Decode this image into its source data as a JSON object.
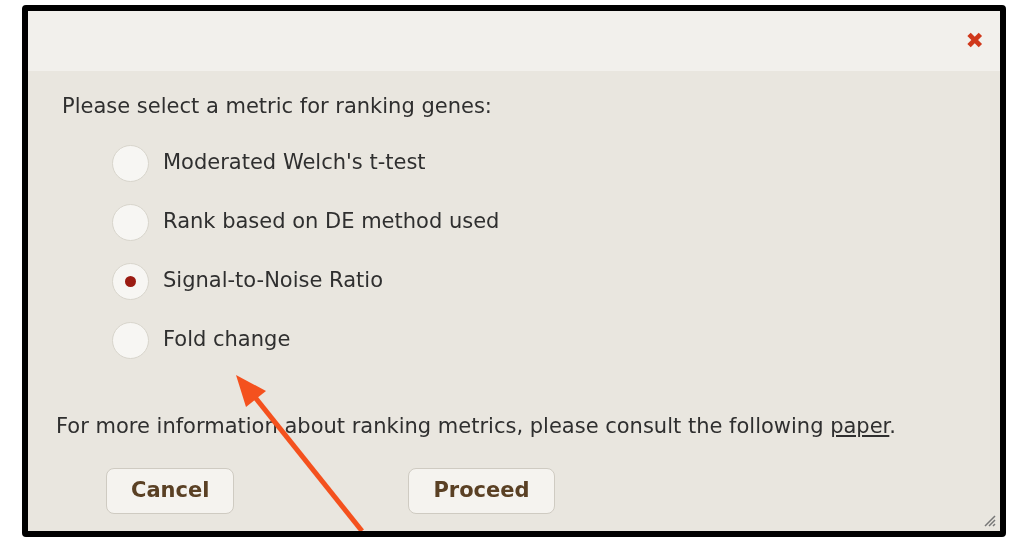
{
  "dialog": {
    "close_icon": "✖",
    "prompt": "Please select a metric for ranking genes:",
    "options": [
      {
        "label": "Moderated Welch's t-test",
        "selected": false
      },
      {
        "label": "Rank based on DE method used",
        "selected": false
      },
      {
        "label": "Signal-to-Noise Ratio",
        "selected": true
      },
      {
        "label": "Fold change",
        "selected": false
      }
    ],
    "info": {
      "text": "For more information about ranking metrics, please consult the following ",
      "link": "paper",
      "after": "."
    },
    "buttons": [
      "Cancel",
      "Proceed"
    ]
  }
}
